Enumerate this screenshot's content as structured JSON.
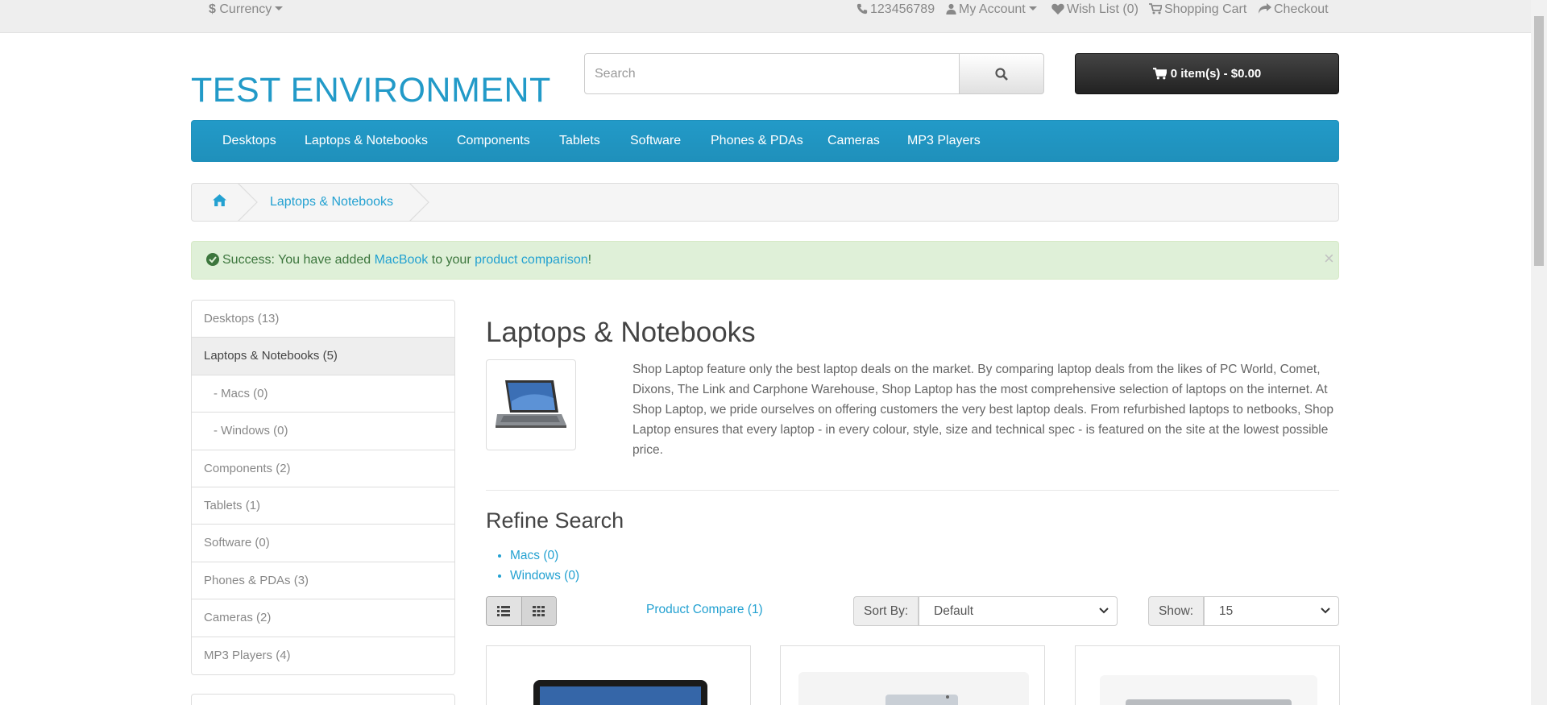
{
  "top_bar": {
    "currency_label": "Currency",
    "phone": "123456789",
    "my_account": "My Account",
    "wish_list": "Wish List (0)",
    "shopping_cart": "Shopping Cart",
    "checkout": "Checkout"
  },
  "header": {
    "logo": "TEST ENVIRONMENT",
    "search_placeholder": "Search",
    "cart_label": "0 item(s) - $0.00"
  },
  "menu": [
    "Desktops",
    "Laptops & Notebooks",
    "Components",
    "Tablets",
    "Software",
    "Phones & PDAs",
    "Cameras",
    "MP3 Players"
  ],
  "breadcrumb": {
    "current": "Laptops & Notebooks"
  },
  "alert": {
    "prefix": "Success: You have added ",
    "product_link": "MacBook",
    "middle": " to your ",
    "comparison_link": "product comparison",
    "suffix": "!",
    "close": "×"
  },
  "categories": [
    "Desktops (13)",
    "Laptops & Notebooks (5)",
    "- Macs (0)",
    "- Windows (0)",
    "Components (2)",
    "Tablets (1)",
    "Software (0)",
    "Phones & PDAs (3)",
    "Cameras (2)",
    "MP3 Players (4)"
  ],
  "content": {
    "title": "Laptops & Notebooks",
    "description": "Shop Laptop feature only the best laptop deals on the market. By comparing laptop deals from the likes of PC World, Comet, Dixons, The Link and Carphone Warehouse, Shop Laptop has the most comprehensive selection of laptops on the internet. At Shop Laptop, we pride ourselves on offering customers the very best laptop deals. From refurbished laptops to netbooks, Shop Laptop ensures that every laptop - in every colour, style, size and technical spec - is featured on the site at the lowest possible price.",
    "refine_title": "Refine Search",
    "refine_items": [
      "Macs (0)",
      "Windows (0)"
    ],
    "compare_link": "Product Compare (1)",
    "sort_label": "Sort By:",
    "sort_value": "Default",
    "show_label": "Show:",
    "show_value": "15"
  },
  "colors": {
    "brand": "#229ac8",
    "link": "#23a1d1",
    "success_bg": "#dff0d8",
    "success_text": "#3c763d"
  }
}
